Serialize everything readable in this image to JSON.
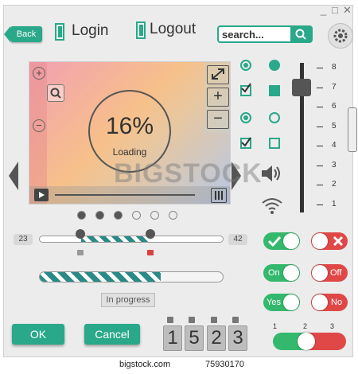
{
  "window": {
    "controls": [
      "_",
      "□",
      "✕"
    ]
  },
  "header": {
    "back_label": "Back",
    "login_label": "Login",
    "logout_label": "Logout",
    "search_value": "search...",
    "search_icon": "search-icon",
    "settings_icon": "gear-icon"
  },
  "player": {
    "progress_percent": "16%",
    "status": "Loading",
    "progress_value": 0.16
  },
  "pagination": {
    "count": 6,
    "active": 3
  },
  "range_slider": {
    "min_label": "23",
    "max_label": "42"
  },
  "progress": {
    "tooltip": "In progress",
    "value": 0.66
  },
  "buttons": {
    "ok": "OK",
    "cancel": "Cancel"
  },
  "counter": {
    "digits": [
      "1",
      "5",
      "2",
      "3"
    ]
  },
  "vertical_slider": {
    "ticks": [
      "8",
      "7",
      "6",
      "5",
      "4",
      "3",
      "2",
      "1"
    ],
    "value": 7
  },
  "toggles": {
    "row2_on": "On",
    "row2_off": "Off",
    "row3_yes": "Yes",
    "row3_no": "No",
    "tri_labels": [
      "1",
      "2",
      "3"
    ],
    "tri_value": 2
  },
  "watermark": {
    "brand": "BIGSTOCK",
    "footer_site": "bigstock.com",
    "footer_id": "75930170"
  }
}
